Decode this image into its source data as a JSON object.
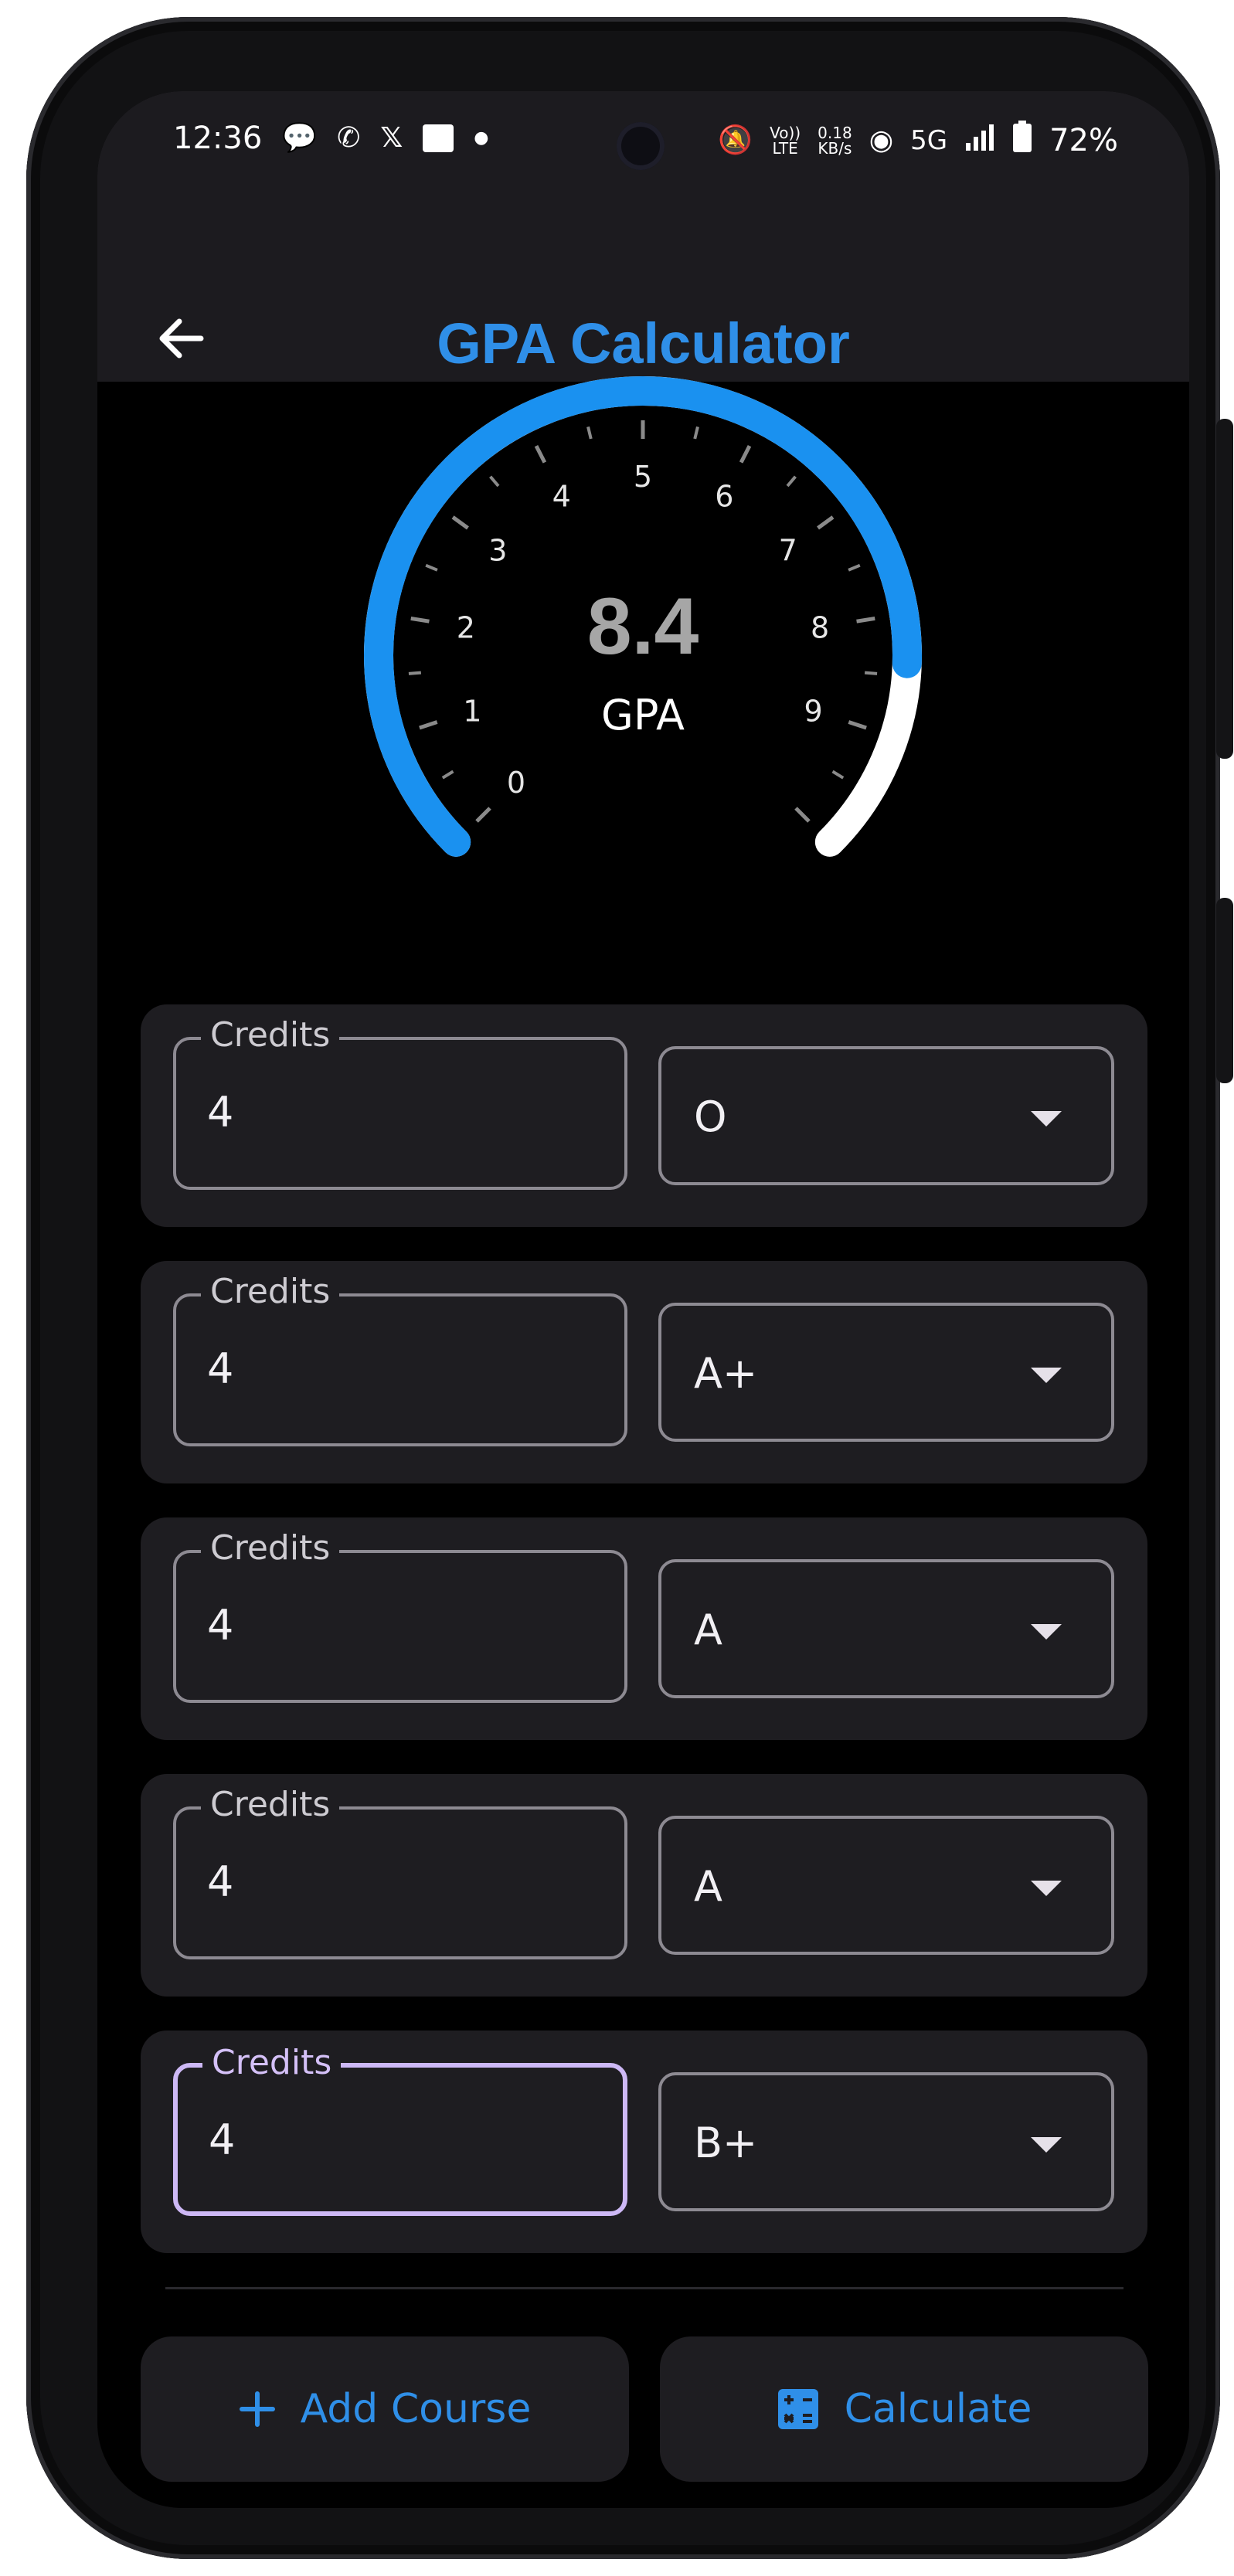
{
  "status_bar": {
    "time": "12:36",
    "left_icons": [
      "chat-bubble-icon",
      "whatsapp-icon",
      "x-icon",
      "app-icon",
      "dot-icon"
    ],
    "volte_top": "Vo))",
    "volte_bottom": "LTE",
    "net_speed_value": "0.18",
    "net_speed_unit": "KB/s",
    "network": "5G",
    "battery": "72%"
  },
  "app_bar": {
    "title": "GPA Calculator",
    "back_icon": "arrow-left-icon"
  },
  "gauge": {
    "value": 8.4,
    "value_text": "8.4",
    "label": "GPA",
    "min": 0,
    "max": 10,
    "tick_labels": [
      "0",
      "1",
      "2",
      "3",
      "4",
      "5",
      "6",
      "7",
      "8",
      "9"
    ],
    "colors": {
      "fill": "#1a91f0",
      "track": "#ffffff",
      "ticks": "#8a8a8a"
    }
  },
  "courses": [
    {
      "credits_label": "Credits",
      "credits": "4",
      "grade": "O",
      "active": false
    },
    {
      "credits_label": "Credits",
      "credits": "4",
      "grade": "A+",
      "active": false
    },
    {
      "credits_label": "Credits",
      "credits": "4",
      "grade": "A",
      "active": false
    },
    {
      "credits_label": "Credits",
      "credits": "4",
      "grade": "A",
      "active": false
    },
    {
      "credits_label": "Credits",
      "credits": "4",
      "grade": "B+",
      "active": true
    }
  ],
  "actions": {
    "add_label": "Add Course",
    "add_icon": "plus-icon",
    "calc_label": "Calculate",
    "calc_icon": "calculator-icon"
  },
  "colors": {
    "accent": "#2f8fe8",
    "focus_border": "#cdb8f5",
    "card_bg": "#1e1d21"
  }
}
